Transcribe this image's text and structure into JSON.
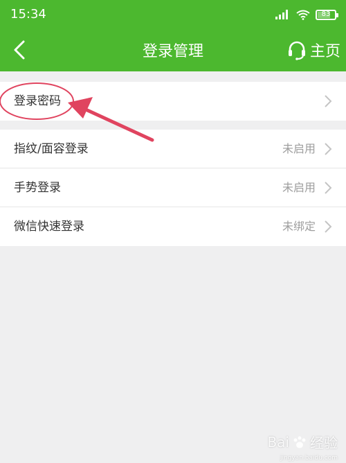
{
  "status_bar": {
    "time": "15:34",
    "battery": "83",
    "battery_level": 0.83
  },
  "header": {
    "title": "登录管理",
    "home_label": "主页"
  },
  "groups": [
    {
      "rows": [
        {
          "label": "登录密码",
          "status": ""
        }
      ]
    },
    {
      "rows": [
        {
          "label": "指纹/面容登录",
          "status": "未启用"
        },
        {
          "label": "手势登录",
          "status": "未启用"
        },
        {
          "label": "微信快速登录",
          "status": "未绑定"
        }
      ]
    }
  ],
  "watermark": {
    "logo": "Bai",
    "text": "经验",
    "sub": "jingyan.baidu.com"
  },
  "colors": {
    "header_green": "#4cb82f",
    "annotation_red": "#e0445f",
    "background": "#efeff0"
  },
  "icons": [
    "back-icon",
    "headset-icon",
    "signal-icon",
    "wifi-icon",
    "battery-icon",
    "chevron-right-icon"
  ]
}
